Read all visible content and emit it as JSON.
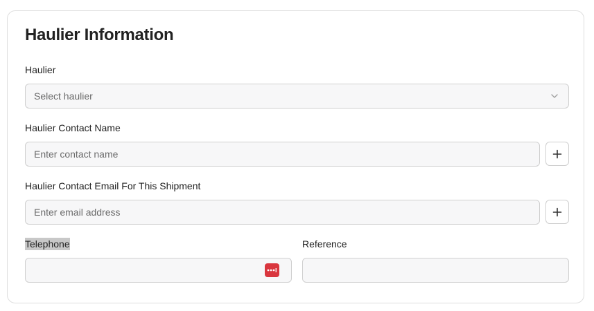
{
  "section": {
    "title": "Haulier Information"
  },
  "haulier": {
    "label": "Haulier",
    "placeholder": "Select haulier"
  },
  "contact_name": {
    "label": "Haulier Contact Name",
    "placeholder": "Enter contact name"
  },
  "contact_email": {
    "label": "Haulier Contact Email For This Shipment",
    "placeholder": "Enter email address"
  },
  "telephone": {
    "label": "Telephone",
    "value": ""
  },
  "reference": {
    "label": "Reference",
    "value": ""
  },
  "icons": {
    "select": "chevron-down-icon",
    "add": "plus-icon",
    "autofill": "password-manager-icon"
  },
  "colors": {
    "autofill_icon": "#d9363e",
    "field_bg": "#f7f7f8",
    "border": "#cfcfcf"
  }
}
